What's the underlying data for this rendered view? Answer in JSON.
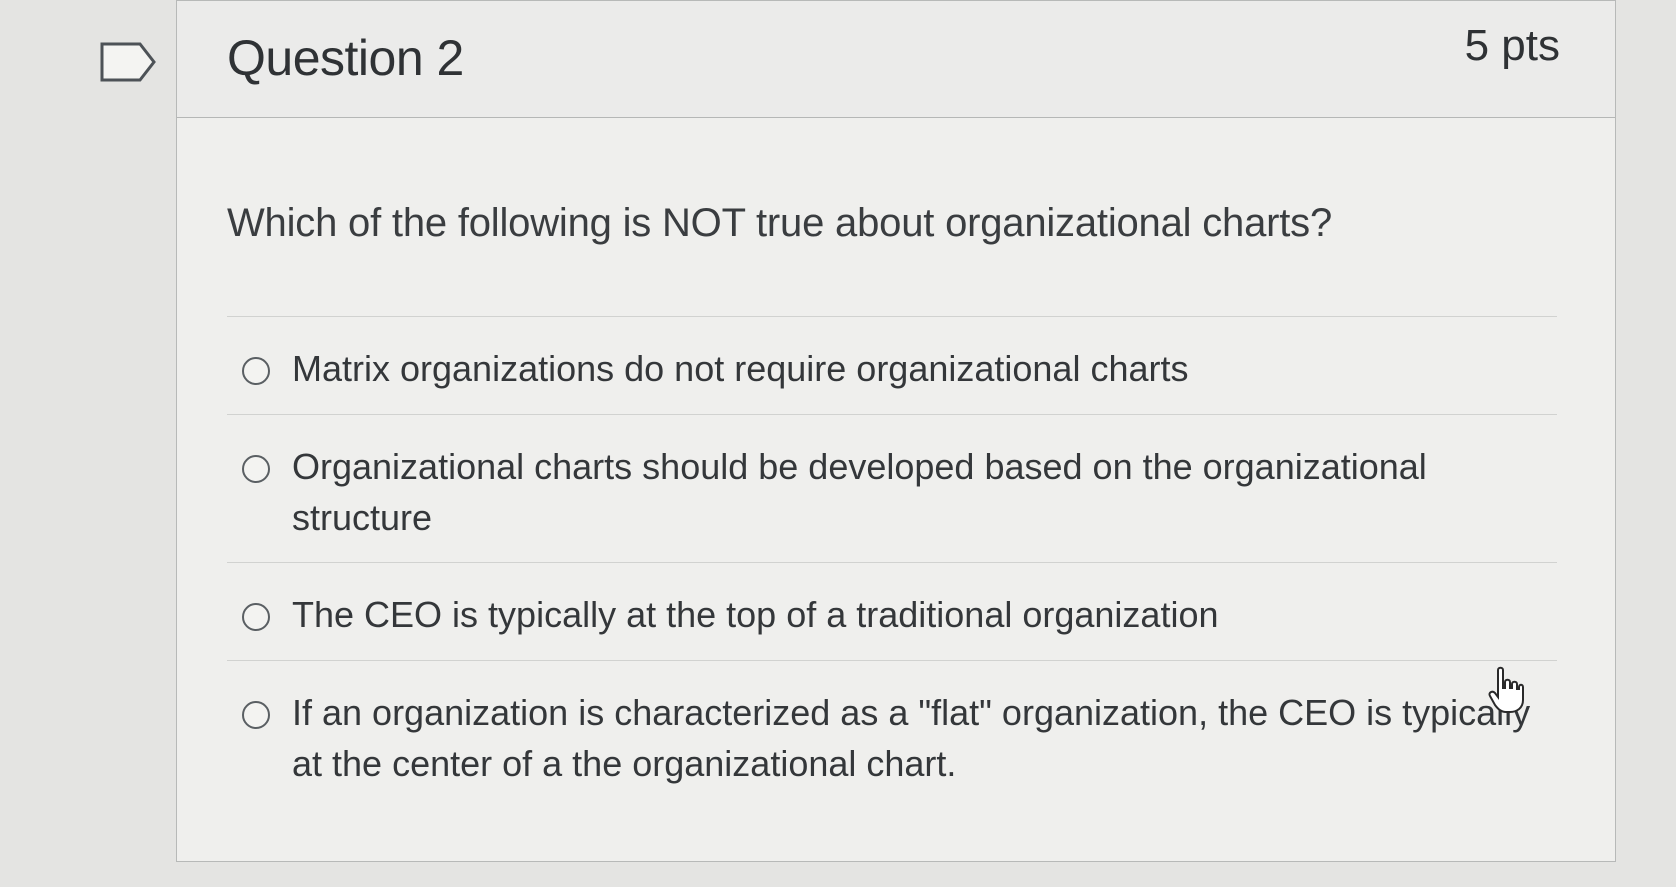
{
  "question": {
    "title": "Question 2",
    "points": "5 pts",
    "text": "Which of the following is NOT true about organizational charts?",
    "answers": [
      {
        "label": "Matrix organizations do not require organizational charts",
        "selected": false
      },
      {
        "label": "Organizational charts should be developed based on the organizational structure",
        "selected": false
      },
      {
        "label": "The CEO is typically at the top of a traditional organization",
        "selected": false
      },
      {
        "label": "If an organization is characterized as a \"flat\" organization, the CEO is typically at the center of a the organizational chart.",
        "selected": false
      }
    ]
  },
  "icons": {
    "flag": "flag-icon",
    "cursor": "hand-pointer-icon"
  },
  "colors": {
    "background": "#e4e4e2",
    "card": "#efefed",
    "text": "#34373a"
  }
}
